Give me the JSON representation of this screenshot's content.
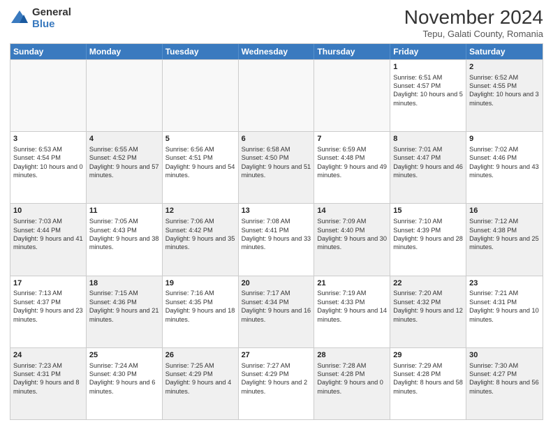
{
  "logo": {
    "general": "General",
    "blue": "Blue"
  },
  "header": {
    "title": "November 2024",
    "subtitle": "Tepu, Galati County, Romania"
  },
  "days": [
    "Sunday",
    "Monday",
    "Tuesday",
    "Wednesday",
    "Thursday",
    "Friday",
    "Saturday"
  ],
  "weeks": [
    [
      {
        "day": "",
        "text": "",
        "empty": true
      },
      {
        "day": "",
        "text": "",
        "empty": true
      },
      {
        "day": "",
        "text": "",
        "empty": true
      },
      {
        "day": "",
        "text": "",
        "empty": true
      },
      {
        "day": "",
        "text": "",
        "empty": true
      },
      {
        "day": "1",
        "text": "Sunrise: 6:51 AM\nSunset: 4:57 PM\nDaylight: 10 hours and 5 minutes.",
        "empty": false
      },
      {
        "day": "2",
        "text": "Sunrise: 6:52 AM\nSunset: 4:55 PM\nDaylight: 10 hours and 3 minutes.",
        "empty": false,
        "shaded": true
      }
    ],
    [
      {
        "day": "3",
        "text": "Sunrise: 6:53 AM\nSunset: 4:54 PM\nDaylight: 10 hours and 0 minutes.",
        "empty": false
      },
      {
        "day": "4",
        "text": "Sunrise: 6:55 AM\nSunset: 4:52 PM\nDaylight: 9 hours and 57 minutes.",
        "empty": false,
        "shaded": true
      },
      {
        "day": "5",
        "text": "Sunrise: 6:56 AM\nSunset: 4:51 PM\nDaylight: 9 hours and 54 minutes.",
        "empty": false
      },
      {
        "day": "6",
        "text": "Sunrise: 6:58 AM\nSunset: 4:50 PM\nDaylight: 9 hours and 51 minutes.",
        "empty": false,
        "shaded": true
      },
      {
        "day": "7",
        "text": "Sunrise: 6:59 AM\nSunset: 4:48 PM\nDaylight: 9 hours and 49 minutes.",
        "empty": false
      },
      {
        "day": "8",
        "text": "Sunrise: 7:01 AM\nSunset: 4:47 PM\nDaylight: 9 hours and 46 minutes.",
        "empty": false,
        "shaded": true
      },
      {
        "day": "9",
        "text": "Sunrise: 7:02 AM\nSunset: 4:46 PM\nDaylight: 9 hours and 43 minutes.",
        "empty": false
      }
    ],
    [
      {
        "day": "10",
        "text": "Sunrise: 7:03 AM\nSunset: 4:44 PM\nDaylight: 9 hours and 41 minutes.",
        "empty": false,
        "shaded": true
      },
      {
        "day": "11",
        "text": "Sunrise: 7:05 AM\nSunset: 4:43 PM\nDaylight: 9 hours and 38 minutes.",
        "empty": false
      },
      {
        "day": "12",
        "text": "Sunrise: 7:06 AM\nSunset: 4:42 PM\nDaylight: 9 hours and 35 minutes.",
        "empty": false,
        "shaded": true
      },
      {
        "day": "13",
        "text": "Sunrise: 7:08 AM\nSunset: 4:41 PM\nDaylight: 9 hours and 33 minutes.",
        "empty": false
      },
      {
        "day": "14",
        "text": "Sunrise: 7:09 AM\nSunset: 4:40 PM\nDaylight: 9 hours and 30 minutes.",
        "empty": false,
        "shaded": true
      },
      {
        "day": "15",
        "text": "Sunrise: 7:10 AM\nSunset: 4:39 PM\nDaylight: 9 hours and 28 minutes.",
        "empty": false
      },
      {
        "day": "16",
        "text": "Sunrise: 7:12 AM\nSunset: 4:38 PM\nDaylight: 9 hours and 25 minutes.",
        "empty": false,
        "shaded": true
      }
    ],
    [
      {
        "day": "17",
        "text": "Sunrise: 7:13 AM\nSunset: 4:37 PM\nDaylight: 9 hours and 23 minutes.",
        "empty": false
      },
      {
        "day": "18",
        "text": "Sunrise: 7:15 AM\nSunset: 4:36 PM\nDaylight: 9 hours and 21 minutes.",
        "empty": false,
        "shaded": true
      },
      {
        "day": "19",
        "text": "Sunrise: 7:16 AM\nSunset: 4:35 PM\nDaylight: 9 hours and 18 minutes.",
        "empty": false
      },
      {
        "day": "20",
        "text": "Sunrise: 7:17 AM\nSunset: 4:34 PM\nDaylight: 9 hours and 16 minutes.",
        "empty": false,
        "shaded": true
      },
      {
        "day": "21",
        "text": "Sunrise: 7:19 AM\nSunset: 4:33 PM\nDaylight: 9 hours and 14 minutes.",
        "empty": false
      },
      {
        "day": "22",
        "text": "Sunrise: 7:20 AM\nSunset: 4:32 PM\nDaylight: 9 hours and 12 minutes.",
        "empty": false,
        "shaded": true
      },
      {
        "day": "23",
        "text": "Sunrise: 7:21 AM\nSunset: 4:31 PM\nDaylight: 9 hours and 10 minutes.",
        "empty": false
      }
    ],
    [
      {
        "day": "24",
        "text": "Sunrise: 7:23 AM\nSunset: 4:31 PM\nDaylight: 9 hours and 8 minutes.",
        "empty": false,
        "shaded": true
      },
      {
        "day": "25",
        "text": "Sunrise: 7:24 AM\nSunset: 4:30 PM\nDaylight: 9 hours and 6 minutes.",
        "empty": false
      },
      {
        "day": "26",
        "text": "Sunrise: 7:25 AM\nSunset: 4:29 PM\nDaylight: 9 hours and 4 minutes.",
        "empty": false,
        "shaded": true
      },
      {
        "day": "27",
        "text": "Sunrise: 7:27 AM\nSunset: 4:29 PM\nDaylight: 9 hours and 2 minutes.",
        "empty": false
      },
      {
        "day": "28",
        "text": "Sunrise: 7:28 AM\nSunset: 4:28 PM\nDaylight: 9 hours and 0 minutes.",
        "empty": false,
        "shaded": true
      },
      {
        "day": "29",
        "text": "Sunrise: 7:29 AM\nSunset: 4:28 PM\nDaylight: 8 hours and 58 minutes.",
        "empty": false
      },
      {
        "day": "30",
        "text": "Sunrise: 7:30 AM\nSunset: 4:27 PM\nDaylight: 8 hours and 56 minutes.",
        "empty": false,
        "shaded": true
      }
    ]
  ]
}
